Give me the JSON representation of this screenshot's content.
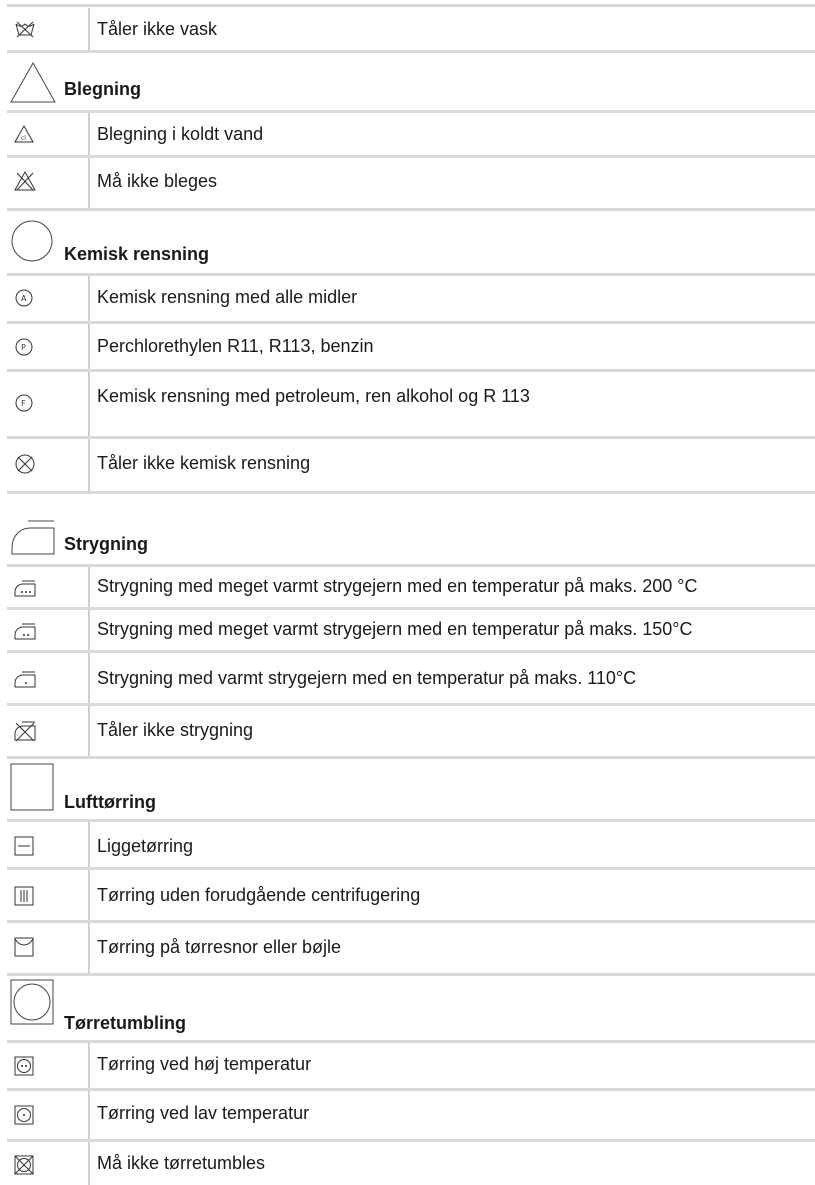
{
  "sections": [
    {
      "title": "",
      "rows": [
        {
          "icon": "no-wash-icon",
          "text": "Tåler ikke vask"
        }
      ]
    },
    {
      "title": "Blegning",
      "icon": "bleach-triangle-icon",
      "rows": [
        {
          "icon": "bleach-cold-icon",
          "text": "Blegning i koldt vand"
        },
        {
          "icon": "no-bleach-icon",
          "text": "Må ikke bleges"
        }
      ]
    },
    {
      "title": "Kemisk rensning",
      "icon": "dry-clean-circle-icon",
      "rows": [
        {
          "icon": "dry-clean-a-icon",
          "text": "Kemisk rensning med alle midler"
        },
        {
          "icon": "dry-clean-p-icon",
          "text": "Perchlorethylen R11, R113, benzin"
        },
        {
          "icon": "dry-clean-f-icon",
          "text": "Kemisk rensning med petroleum, ren alkohol og R 113"
        },
        {
          "icon": "no-dry-clean-icon",
          "text": "Tåler ikke kemisk rensning"
        }
      ]
    },
    {
      "title": "Strygning",
      "icon": "iron-icon",
      "rows": [
        {
          "icon": "iron-3dot-icon",
          "text": "Strygning med meget varmt strygejern med en temperatur på maks. 200 °C"
        },
        {
          "icon": "iron-2dot-icon",
          "text": "Strygning med meget varmt strygejern med en temperatur på maks. 150°C"
        },
        {
          "icon": "iron-1dot-icon",
          "text": "Strygning med varmt strygejern med en temperatur på maks. 110°C"
        },
        {
          "icon": "no-iron-icon",
          "text": "Tåler ikke strygning"
        }
      ]
    },
    {
      "title": "Lufttørring",
      "icon": "air-dry-square-icon",
      "rows": [
        {
          "icon": "dry-flat-icon",
          "text": "Liggetørring"
        },
        {
          "icon": "drip-dry-icon",
          "text": "Tørring uden forudgående centrifugering"
        },
        {
          "icon": "line-dry-icon",
          "text": "Tørring på tørresnor eller bøjle"
        }
      ]
    },
    {
      "title": "Tørretumbling",
      "icon": "tumble-dry-icon",
      "rows": [
        {
          "icon": "tumble-high-icon",
          "text": "Tørring ved høj temperatur"
        },
        {
          "icon": "tumble-low-icon",
          "text": "Tørring ved lav temperatur"
        },
        {
          "icon": "no-tumble-icon",
          "text": "Må ikke tørretumbles"
        }
      ]
    }
  ]
}
